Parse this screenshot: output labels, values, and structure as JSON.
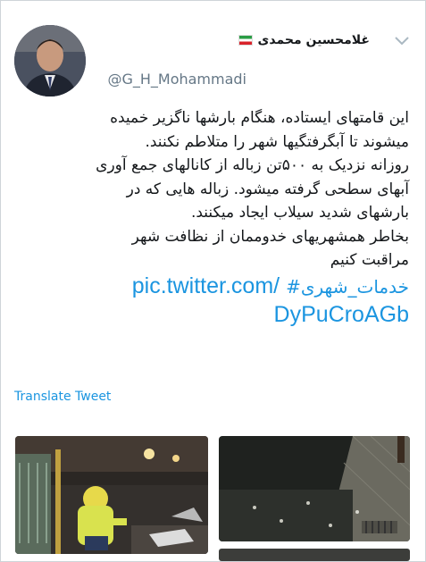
{
  "user": {
    "display_name": "غلامحسین محمدی",
    "handle": "@G_H_Mohammadi",
    "avatar": "profile-photo",
    "flag": "iran-flag"
  },
  "tweet": {
    "lines": [
      "این قامتهای ایستاده، هنگام بارشها ناگزیر خمیده",
      "میشوند تا آبگرفتگیها شهر را متلاطم نکنند.",
      "روزانه نزدیک به ۵۰۰تن زباله از کانالهای جمع آوری",
      "آبهای سطحی گرفته میشود. زباله هایی که در",
      "بارشهای شدید سیلاب ایجاد میکنند.",
      "بخاطر همشهریهای خدوممان از نظافت شهر",
      "مراقبت کنیم"
    ],
    "hashtag": "#خدمات_شهری",
    "link_part1": "pic.twitter.com/",
    "link_part2": "DyPuCroAGb"
  },
  "translate_label": "Translate Tweet",
  "media": [
    "street-worker-photo",
    "flooded-street-photo",
    "third-photo-strip"
  ],
  "icons": {
    "menu": "chevron-down-icon"
  }
}
